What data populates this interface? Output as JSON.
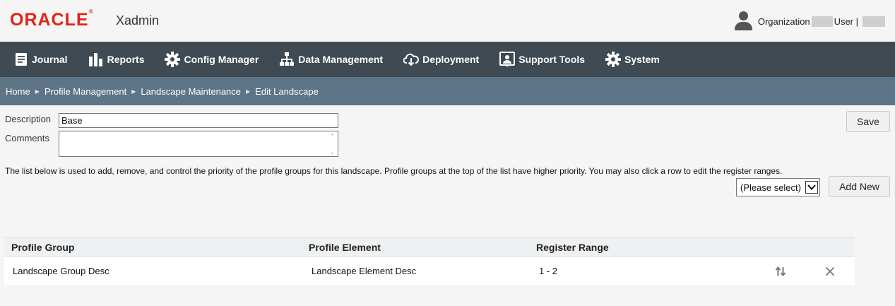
{
  "header": {
    "brand": "ORACLE",
    "app_name": "Xadmin",
    "org_label": "Organization",
    "user_label": "User |"
  },
  "nav": {
    "items": [
      {
        "label": "Journal",
        "icon": "journal-icon"
      },
      {
        "label": "Reports",
        "icon": "bar-chart-icon"
      },
      {
        "label": "Config Manager",
        "icon": "gear-icon"
      },
      {
        "label": "Data Management",
        "icon": "hierarchy-icon"
      },
      {
        "label": "Deployment",
        "icon": "cloud-download-icon"
      },
      {
        "label": "Support Tools",
        "icon": "support-icon"
      },
      {
        "label": "System",
        "icon": "gear-icon"
      }
    ]
  },
  "breadcrumb": [
    "Home",
    "Profile Management",
    "Landscape Maintenance",
    "Edit Landscape"
  ],
  "form": {
    "description_label": "Description",
    "description_value": "Base",
    "comments_label": "Comments",
    "comments_value": "",
    "save_label": "Save",
    "info_text": "The list below is used to add, remove, and control the priority of the profile groups for this landscape. Profile groups at the top of the list have higher priority. You may also click a row to edit the register ranges.",
    "select_value": "(Please select)",
    "add_new_label": "Add New"
  },
  "table": {
    "headers": [
      "Profile Group",
      "Profile Element",
      "Register Range"
    ],
    "rows": [
      {
        "group": "Landscape Group Desc",
        "element": "Landscape Element Desc",
        "range": "1 - 2"
      }
    ]
  },
  "colors": {
    "brand_red": "#e2231a",
    "nav_bg": "#3f4a52",
    "breadcrumb_bg": "#5e7487"
  }
}
